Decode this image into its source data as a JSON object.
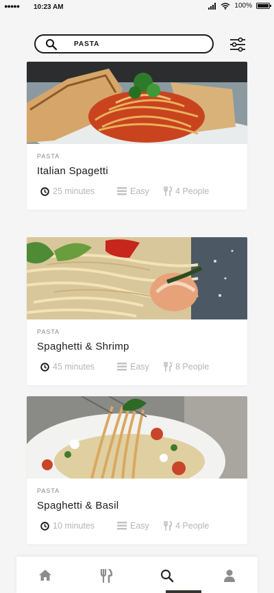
{
  "status": {
    "signal": "●●●●●",
    "time": "10:23 AM",
    "battery": "100%"
  },
  "search": {
    "value": "PASTA",
    "placeholder": ""
  },
  "recipes": [
    {
      "category": "PASTA",
      "title": "Italian Spagetti",
      "time": "25 minutes",
      "difficulty": "Easy",
      "servings": "4 People"
    },
    {
      "category": "PASTA",
      "title": "Spaghetti & Shrimp",
      "time": "45 minutes",
      "difficulty": "Easy",
      "servings": "8 People"
    },
    {
      "category": "PASTA",
      "title": "Spaghetti & Basil",
      "time": "10 minutes",
      "difficulty": "Easy",
      "servings": "4 People"
    }
  ],
  "nav": {
    "items": [
      "home-icon",
      "utensils-icon",
      "search-icon",
      "user-icon"
    ],
    "active": "search"
  },
  "colors": {
    "background": "#f5f5f5",
    "card": "#ffffff",
    "meta_text": "#b5b5b5",
    "active_indicator": "#3a3330"
  }
}
